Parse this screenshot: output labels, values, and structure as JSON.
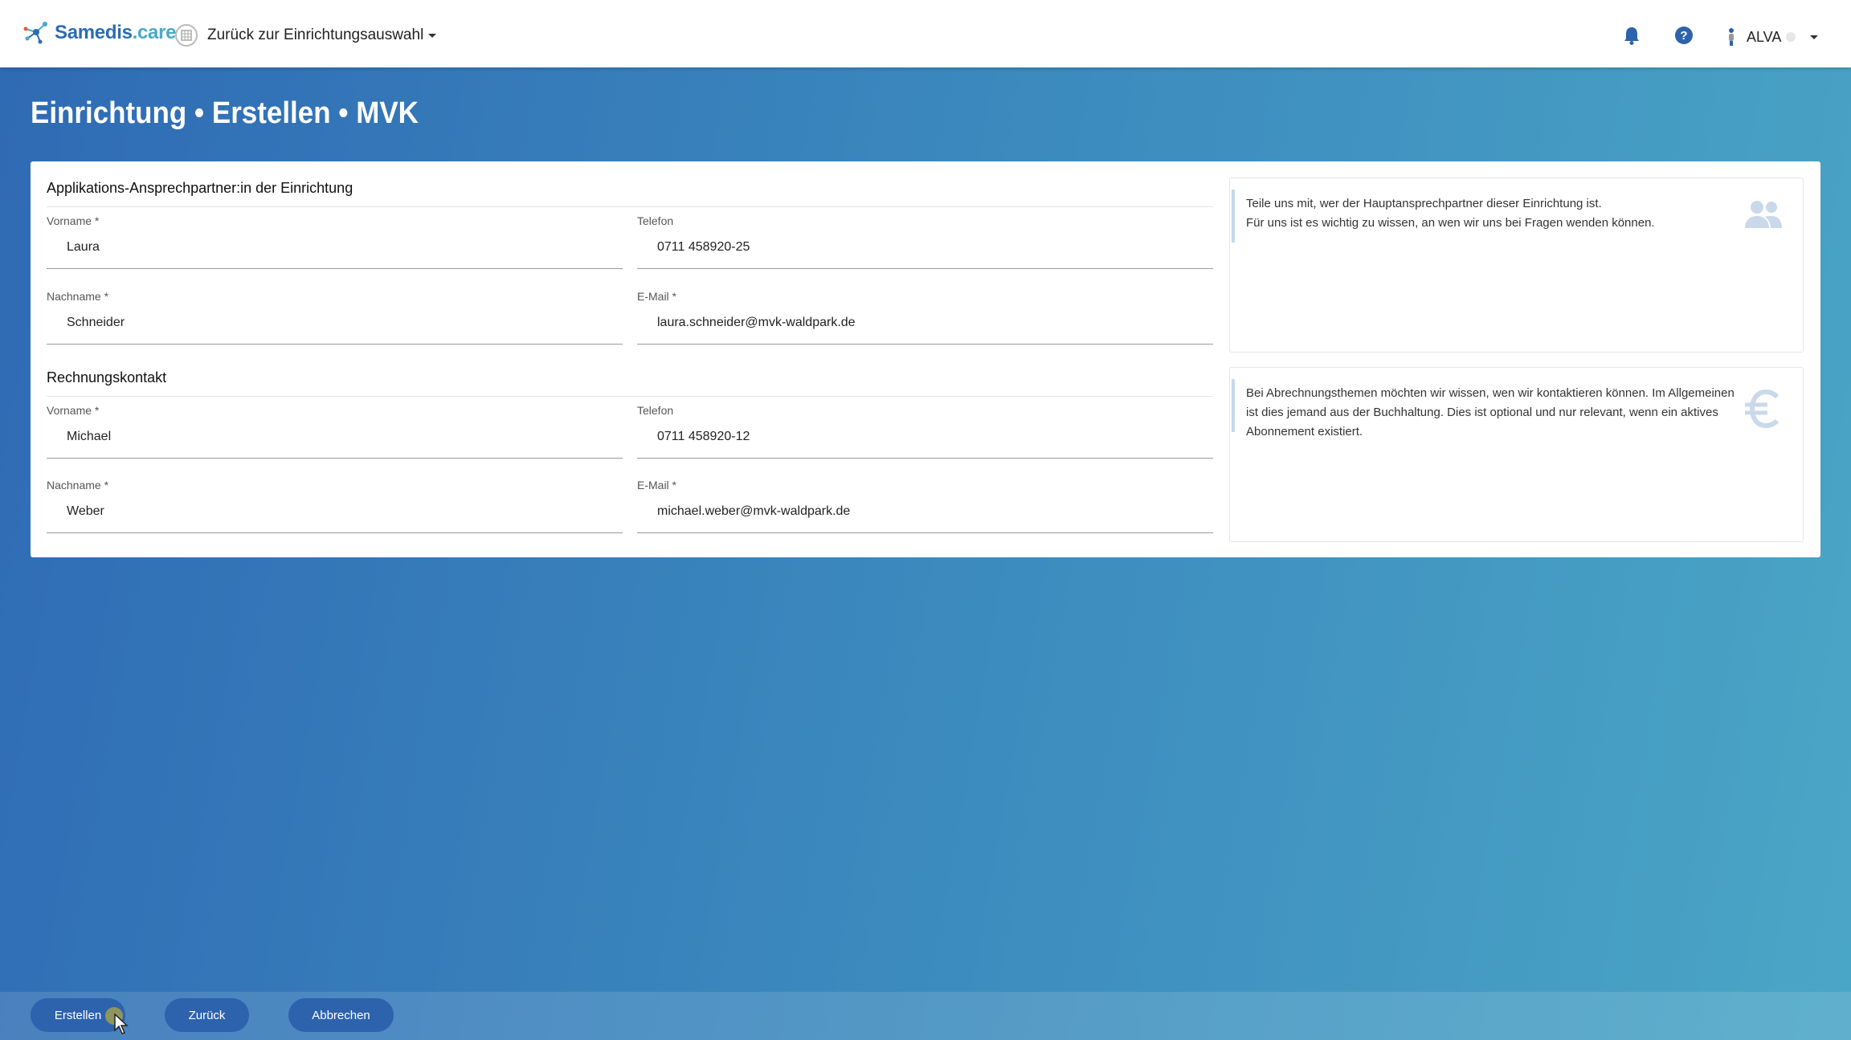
{
  "header": {
    "logo_main": "Samedis",
    "logo_suffix": ".care",
    "facility_switch_label": "Zurück zur Einrichtungsauswahl",
    "user_name": "ALVA"
  },
  "page": {
    "title": "Einrichtung • Erstellen • MVK"
  },
  "app_contact": {
    "title": "Applikations-Ansprechpartner:in der Einrichtung",
    "first_name_label": "Vorname *",
    "first_name": "Laura",
    "last_name_label": "Nachname *",
    "last_name": "Schneider",
    "phone_label": "Telefon",
    "phone": "0711 458920-25",
    "email_label": "E-Mail *",
    "email": "laura.schneider@mvk-waldpark.de",
    "info_line1": "Teile uns mit, wer der Hauptansprechpartner dieser Einrichtung ist.",
    "info_line2": "Für uns ist es wichtig zu wissen, an wen wir uns bei Fragen wenden können."
  },
  "billing_contact": {
    "title": "Rechnungskontakt",
    "first_name_label": "Vorname *",
    "first_name": "Michael",
    "last_name_label": "Nachname *",
    "last_name": "Weber",
    "phone_label": "Telefon",
    "phone": "0711 458920-12",
    "email_label": "E-Mail *",
    "email": "michael.weber@mvk-waldpark.de",
    "info_text": "Bei Abrechnungsthemen möchten wir wissen, wen wir kontaktieren können. Im Allgemeinen ist dies jemand aus der Buchhaltung. Dies ist optional und nur relevant, wenn ein aktives Abonnement existiert."
  },
  "footer": {
    "create_label": "Erstellen",
    "back_label": "Zurück",
    "cancel_label": "Abbrechen"
  },
  "icons": {
    "logo": "samedis-logo-icon",
    "facility": "building-icon",
    "notifications": "bell-icon",
    "help": "help-icon",
    "user": "user-avatar-icon",
    "contact_info": "people-icon",
    "billing_info": "euro-icon"
  },
  "colors": {
    "brand_blue": "#2d6bb3",
    "brand_teal": "#48a9c8",
    "button": "#2d62ad",
    "info_icon": "#c9d9ea"
  }
}
